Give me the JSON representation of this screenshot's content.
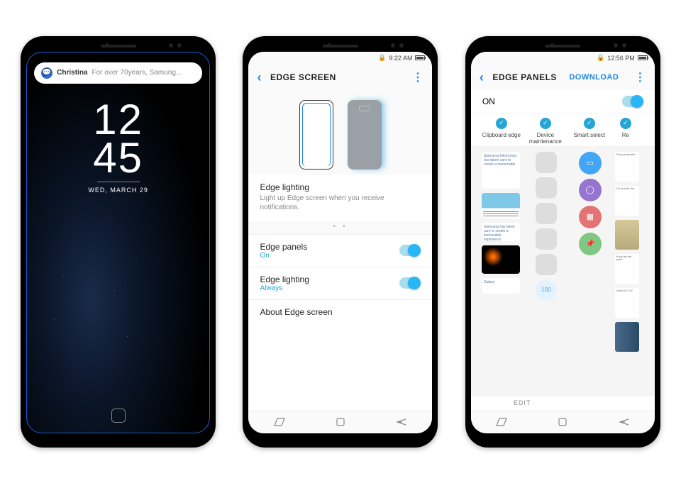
{
  "phone1": {
    "notification_sender": "Christina",
    "notification_preview": "For over 70years, Samung...",
    "clock_hours": "12",
    "clock_minutes": "45",
    "date": "WED, MARCH 29"
  },
  "phone2": {
    "status_time": "9:22 AM",
    "header_title": "EDGE SCREEN",
    "card_title": "Edge lighting",
    "card_desc": "Light up Edge screen when you receive notifications.",
    "row1_title": "Edge panels",
    "row1_sub": "On",
    "row2_title": "Edge lighting",
    "row2_sub": "Always",
    "row3_title": "About Edge screen"
  },
  "phone3": {
    "status_time": "12:56 PM",
    "header_title": "EDGE PANELS",
    "header_action": "DOWNLOAD",
    "on_label": "ON",
    "cols": {
      "c1": "Clipboard edge",
      "c2": "Device maintenance",
      "c3": "Smart select",
      "c4": "Re"
    },
    "clip_text1": "Samsung Electronics has taken care to create a memorable",
    "clip_text2": "Samsung has taken care to create a memorable experience.",
    "clip_text3": "Galaxy",
    "num_label": "100",
    "edit_label": "EDIT"
  }
}
